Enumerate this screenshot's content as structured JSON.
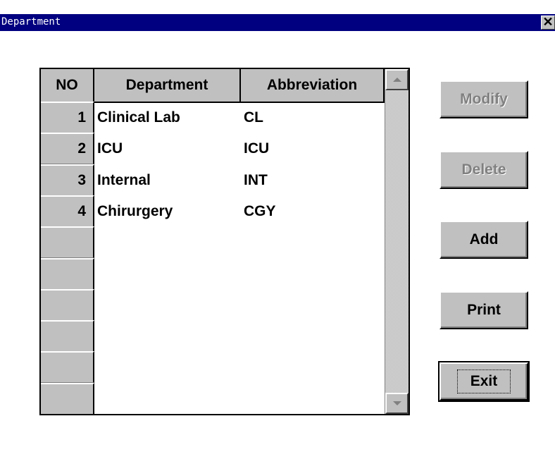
{
  "window": {
    "title": "Department",
    "close_glyph": "✕"
  },
  "table": {
    "columns": [
      "NO",
      "Department",
      "Abbreviation"
    ],
    "rows": [
      {
        "no": "1",
        "department": "Clinical Lab",
        "abbreviation": "CL"
      },
      {
        "no": "2",
        "department": "ICU",
        "abbreviation": "ICU"
      },
      {
        "no": "3",
        "department": "Internal",
        "abbreviation": "INT"
      },
      {
        "no": "4",
        "department": "Chirurgery",
        "abbreviation": "CGY"
      },
      {
        "no": "",
        "department": "",
        "abbreviation": ""
      },
      {
        "no": "",
        "department": "",
        "abbreviation": ""
      },
      {
        "no": "",
        "department": "",
        "abbreviation": ""
      },
      {
        "no": "",
        "department": "",
        "abbreviation": ""
      },
      {
        "no": "",
        "department": "",
        "abbreviation": ""
      },
      {
        "no": "",
        "department": "",
        "abbreviation": ""
      }
    ]
  },
  "buttons": {
    "modify": {
      "label": "Modify",
      "enabled": false
    },
    "delete": {
      "label": "Delete",
      "enabled": false
    },
    "add": {
      "label": "Add",
      "enabled": true
    },
    "print": {
      "label": "Print",
      "enabled": true
    },
    "exit": {
      "label": "Exit",
      "enabled": true
    }
  },
  "colors": {
    "titlebar": "#000080",
    "face": "#c0c0c0",
    "disabled_text": "#808080"
  }
}
